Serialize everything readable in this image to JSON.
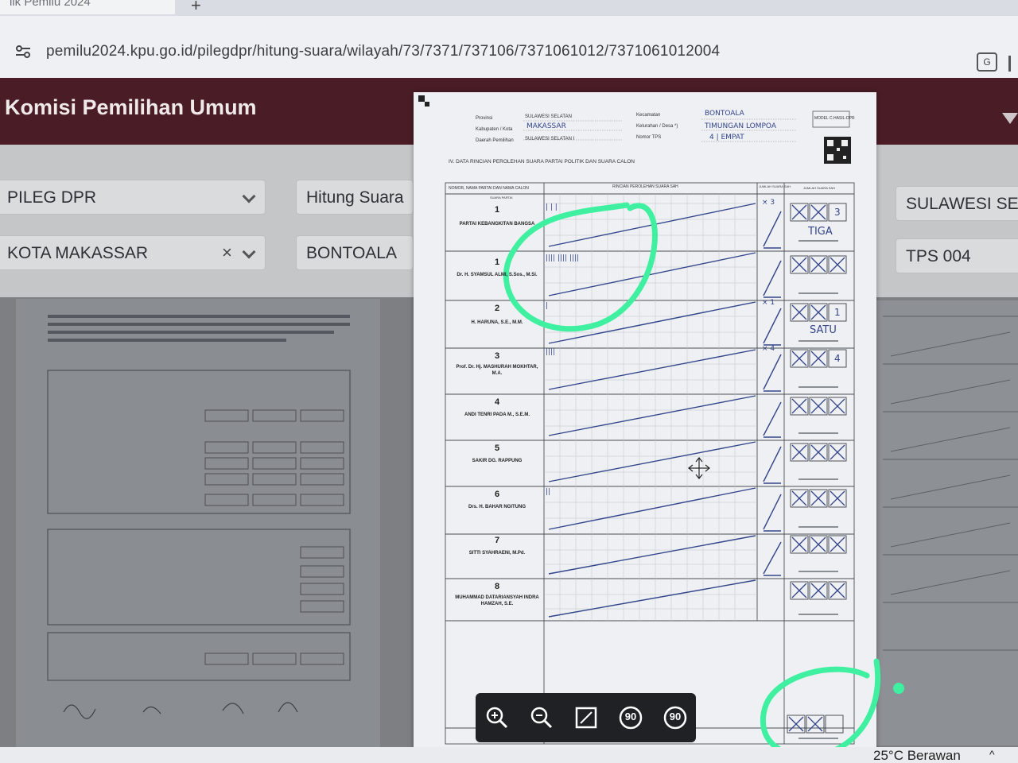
{
  "browser": {
    "tab_title": "lik Pemilu 2024",
    "tab_close": "×",
    "new_tab": "+",
    "url": "pemilu2024.kpu.go.id/pilegdpr/hitung-suara/wilayah/73/7371/737106/7371061012/7371061012004"
  },
  "site": {
    "title": "Komisi Pemilihan Umum"
  },
  "filters": {
    "election_type": "PILEG DPR",
    "view": "Hitung Suara",
    "province": "SULAWESI SELA",
    "city": "KOTA MAKASSAR",
    "district": "BONTOALA",
    "tps": "TPS 004",
    "clear_symbol": "×"
  },
  "document": {
    "header_labels": [
      "Provinsi",
      "Kabupaten / Kota",
      "Daerah Pemilihan",
      "Kecamatan",
      "Kelurahan / Desa *)",
      "Nomor TPS"
    ],
    "header_values": [
      "SULAWESI SELATAN",
      "MAKASSAR",
      "SULAWESI SELATAN I",
      "BONTOALA",
      "TIMUNGAN LOMPOA",
      "4 | EMPAT"
    ],
    "form_code": "MODEL C.HASIL-DPR",
    "section_title": "IV.  DATA RINCIAN PEROLEHAN SUARA PARTAI POLITIK DAN SUARA CALON",
    "col_headers": [
      "NOMOR, NAMA PARTAI DAN NAMA CALON",
      "RINCIAN PEROLEHAN SUARA SAH",
      "JUMLAH SUARA SAH",
      "JUMLAH SUARA SAH"
    ],
    "party_label": "SUARA PARTAI",
    "party_no": "1",
    "party_name": "PARTAI KEBANGKITAN BANGSA",
    "party_total_word": "TIGA",
    "candidates": [
      {
        "no": "1",
        "name": "Dr. H. SYAMSUL ALMI, S.Sos., M.Si.",
        "total_word": ""
      },
      {
        "no": "2",
        "name": "H. HARUNA, S.E., M.M.",
        "total_word": "SATU"
      },
      {
        "no": "3",
        "name": "Prof. Dr. Hj. MASHURAH MOKHTAR, M.A.",
        "total_word": ""
      },
      {
        "no": "4",
        "name": "ANDI TENRI PADA M., S.E.M.",
        "total_word": ""
      },
      {
        "no": "5",
        "name": "SAKIR DG. RAPPUNG",
        "total_word": ""
      },
      {
        "no": "6",
        "name": "Drs. H. BAHAR NGITUNG",
        "total_word": ""
      },
      {
        "no": "7",
        "name": "SITTI SYAHRAENI, M.Pd.",
        "total_word": ""
      },
      {
        "no": "8",
        "name": "MUHAMMAD DATARIANSYAH INDRA HAMZAH, S.E.",
        "total_word": ""
      }
    ],
    "tally_marks": [
      "| | |",
      "|||| |||| ||||",
      "|",
      "||||",
      "",
      "",
      "||",
      "",
      ""
    ],
    "subtotal_marks": [
      "× 3",
      "",
      "× 1",
      "× 4",
      "",
      "",
      "",
      "",
      ""
    ],
    "digit_boxes": [
      "3",
      "",
      "1",
      "4",
      "",
      "",
      "",
      "",
      ""
    ]
  },
  "viewer": {
    "zoom_in": "zoom-in",
    "zoom_out": "zoom-out",
    "fit": "fit-screen",
    "rotate_left": "90",
    "rotate_right": "90"
  },
  "taskbar": {
    "weather": "25°C  Berawan",
    "tray_chevron": "^"
  },
  "colors": {
    "header_bg": "#4a1c26",
    "annotation": "#3ef0a0",
    "ink": "#33458a"
  }
}
